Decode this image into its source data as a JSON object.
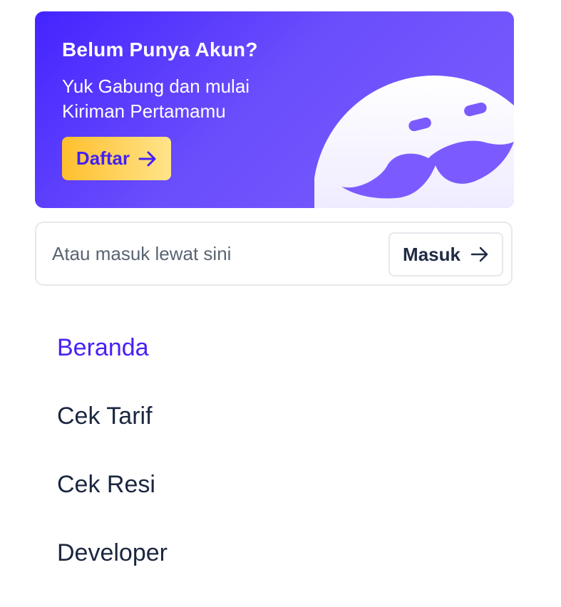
{
  "promo": {
    "title": "Belum Punya Akun?",
    "subtitle": "Yuk Gabung dan mulai Kiriman Pertamamu",
    "register_label": "Daftar",
    "register_icon": "arrow-right-icon",
    "mascot_icon": "mustache-face-illustration",
    "colors": {
      "gradient_start": "#4424ff",
      "gradient_end": "#7c5ffd",
      "button_start": "#ffbf2e",
      "button_end": "#ffe48a",
      "button_text": "#4320f6"
    }
  },
  "login": {
    "hint": "Atau masuk lewat sini",
    "button_label": "Masuk",
    "button_icon": "arrow-right-icon"
  },
  "nav": {
    "items": [
      {
        "label": "Beranda",
        "active": true
      },
      {
        "label": "Cek Tarif",
        "active": false
      },
      {
        "label": "Cek Resi",
        "active": false
      },
      {
        "label": "Developer",
        "active": false
      }
    ],
    "active_color": "#4a1ff5",
    "text_color": "#1b2640"
  }
}
